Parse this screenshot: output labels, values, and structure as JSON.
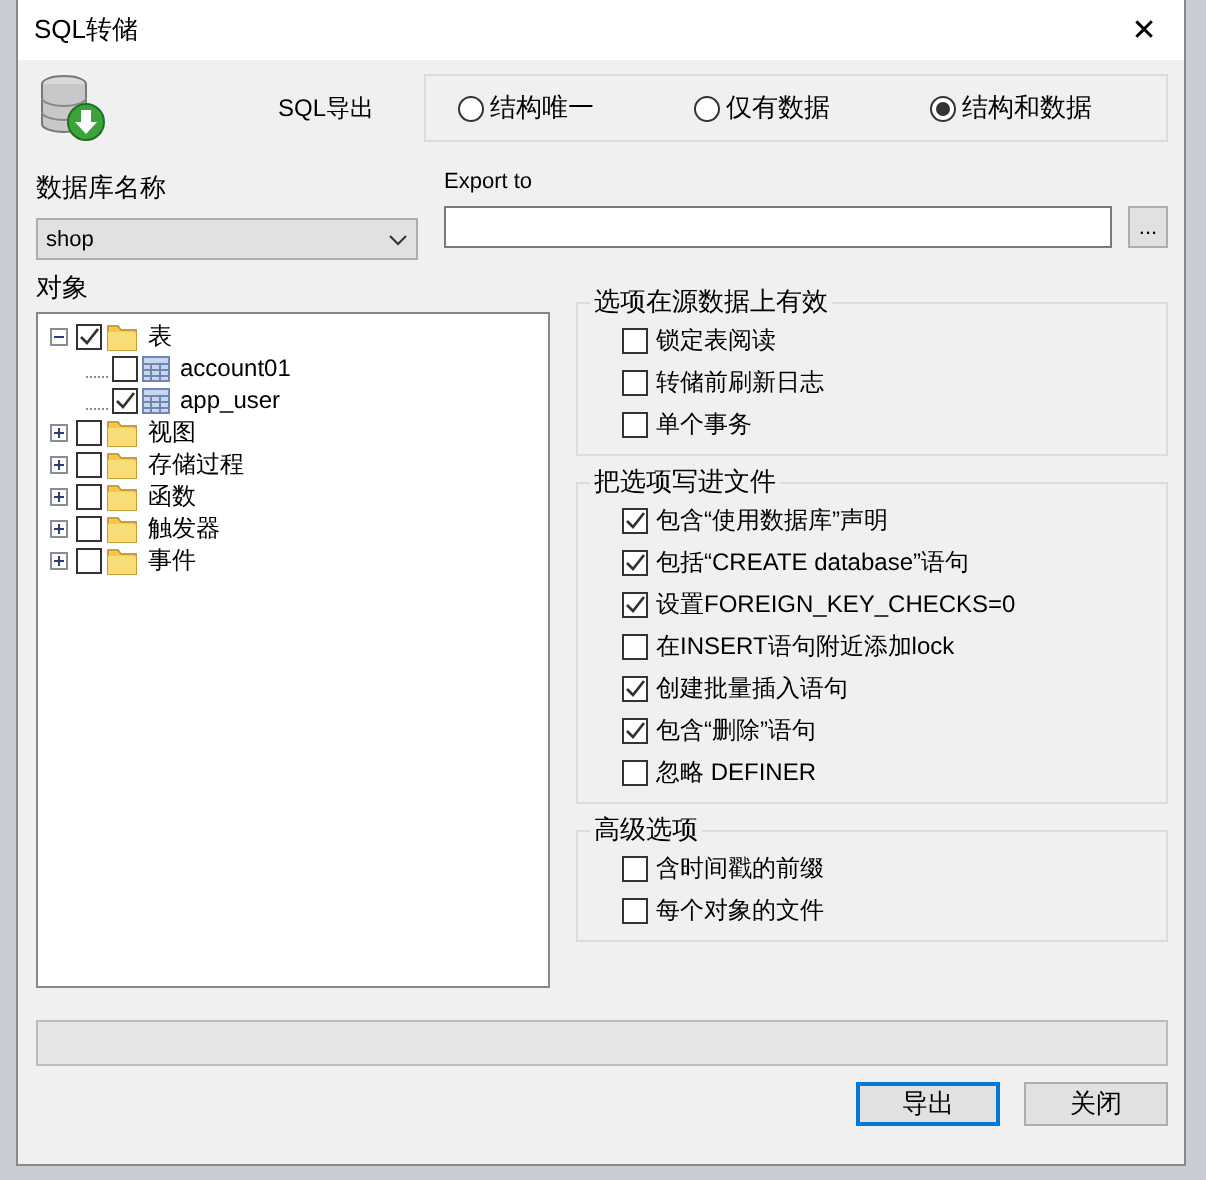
{
  "window": {
    "title": "SQL转储",
    "close": "✕"
  },
  "header": {
    "label": "SQL导出"
  },
  "mode_options": [
    {
      "label": "结构唯一",
      "selected": false
    },
    {
      "label": "仅有数据",
      "selected": false
    },
    {
      "label": "结构和数据",
      "selected": true
    }
  ],
  "database": {
    "label": "数据库名称",
    "value": "shop"
  },
  "export_to": {
    "label": "Export to",
    "browse": "..."
  },
  "objects": {
    "label": "对象",
    "tree": [
      {
        "label": "表",
        "kind": "folder",
        "checked": true,
        "expanded": true,
        "children": [
          {
            "label": "account01",
            "kind": "table",
            "checked": false
          },
          {
            "label": "app_user",
            "kind": "table",
            "checked": true
          }
        ]
      },
      {
        "label": "视图",
        "kind": "folder",
        "checked": false,
        "expanded": false
      },
      {
        "label": "存储过程",
        "kind": "folder",
        "checked": false,
        "expanded": false
      },
      {
        "label": "函数",
        "kind": "folder",
        "checked": false,
        "expanded": false
      },
      {
        "label": "触发器",
        "kind": "folder",
        "checked": false,
        "expanded": false
      },
      {
        "label": "事件",
        "kind": "folder",
        "checked": false,
        "expanded": false
      }
    ]
  },
  "groups": [
    {
      "title": "选项在源数据上有效",
      "options": [
        {
          "label": "锁定表阅读",
          "checked": false
        },
        {
          "label": "转储前刷新日志",
          "checked": false
        },
        {
          "label": "单个事务",
          "checked": false
        }
      ]
    },
    {
      "title": "把选项写进文件",
      "options": [
        {
          "label": "包含“使用数据库”声明",
          "checked": true
        },
        {
          "label": "包括“CREATE database”语句",
          "checked": true
        },
        {
          "label": "设置FOREIGN_KEY_CHECKS=0",
          "checked": true
        },
        {
          "label": "在INSERT语句附近添加lock",
          "checked": false
        },
        {
          "label": "创建批量插入语句",
          "checked": true
        },
        {
          "label": "包含“删除”语句",
          "checked": true
        },
        {
          "label": "忽略 DEFINER",
          "checked": false
        }
      ]
    },
    {
      "title": "高级选项",
      "options": [
        {
          "label": "含时间戳的前缀",
          "checked": false
        },
        {
          "label": "每个对象的文件",
          "checked": false
        }
      ]
    }
  ],
  "buttons": [
    {
      "label": "导出",
      "default": true
    },
    {
      "label": "关闭",
      "default": false
    }
  ]
}
